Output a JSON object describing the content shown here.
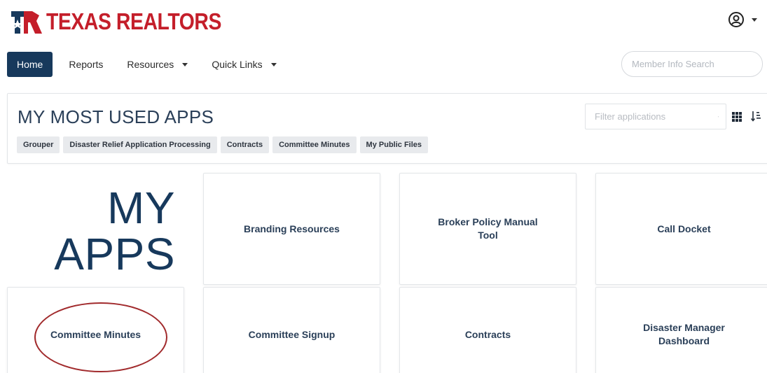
{
  "brand": {
    "name": "TEXAS REALTORS",
    "accent": "#c41e2a",
    "navy": "#17395c"
  },
  "header": {
    "user_icon": "user-circle-icon"
  },
  "nav": {
    "items": [
      {
        "label": "Home",
        "active": true,
        "dropdown": false
      },
      {
        "label": "Reports",
        "active": false,
        "dropdown": false
      },
      {
        "label": "Resources",
        "active": false,
        "dropdown": true
      },
      {
        "label": "Quick Links",
        "active": false,
        "dropdown": true
      }
    ]
  },
  "search": {
    "placeholder": "Member Info Search",
    "value": ""
  },
  "most_used": {
    "title": "MY MOST USED APPS",
    "chips": [
      "Grouper",
      "Disaster Relief Application Processing",
      "Contracts",
      "Committee Minutes",
      "My Public Files"
    ],
    "filter_placeholder": "Filter applications"
  },
  "my_apps": {
    "title_line1": "MY",
    "title_line2": "APPS",
    "tiles": [
      "Branding Resources",
      "Broker Policy Manual Tool",
      "Call Docket",
      "Committee Minutes",
      "Committee Signup",
      "Contracts",
      "Disaster Manager Dashboard"
    ]
  }
}
